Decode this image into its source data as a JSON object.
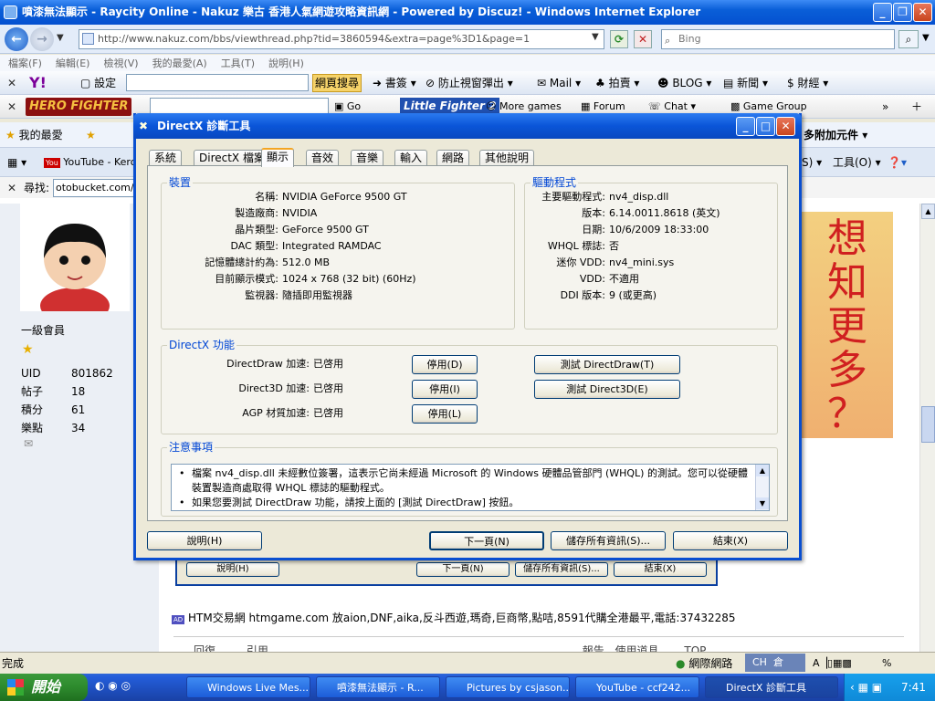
{
  "ie": {
    "title": "噴漆無法顯示 - Raycity Online - Nakuz 樂古 香港人氣網遊攻略資訊網 - Powered by Discuz! - Windows Internet Explorer",
    "address": "http://www.nakuz.com/bbs/viewthread.php?tid=3860594&extra=page%3D1&page=1",
    "search_placeholder": "Bing",
    "menu": [
      "檔案(F)",
      "編輯(E)",
      "檢視(V)",
      "我的最愛(A)",
      "工具(T)",
      "說明(H)"
    ],
    "yahoo_toolbar": {
      "settings": "設定",
      "search_btn": "網頁搜尋",
      "bookmarks": "書簽",
      "popup_block": "防止視窗彈出",
      "mail": "Mail",
      "auction": "拍賣",
      "blog": "BLOG",
      "news": "新聞",
      "finance": "財經"
    },
    "game_toolbar": {
      "brand": "HERO FIGHTER",
      "go": "Go",
      "game": "Little Fighter 2",
      "more_games": "More games",
      "forum": "Forum",
      "chat": "Chat",
      "group": "Game Group"
    },
    "fav_bar": {
      "favorites": "我的最愛",
      "addons": "多附加元件"
    },
    "cmd_bar": {
      "youtube_tab": "YouTube - Kero",
      "tools": "工具(O)"
    },
    "find_bar": {
      "label": "尋找:",
      "value": "otobucket.com/al"
    },
    "status_text": "完成",
    "zone": "網際網路",
    "zoom": "%"
  },
  "forum": {
    "rank": "一級會員",
    "stats": [
      {
        "k": "UID",
        "v": "801862"
      },
      {
        "k": "帖子",
        "v": "18"
      },
      {
        "k": "積分",
        "v": "61"
      },
      {
        "k": "樂點",
        "v": "34"
      }
    ],
    "ad_text": "HTM交易網 htmgame.com 放aion,DNF,aika,反斗西遊,瑪奇,巨商幣,點咭,8591代購全港最平,電話:37432285",
    "reply": "回復",
    "quote": "引用",
    "report": "報告",
    "use_item": "使用道具",
    "top": "TOP",
    "banner": [
      "想",
      "知",
      "更",
      "多",
      "？"
    ],
    "bg_buttons": [
      "說明(H)",
      "下一頁(N)",
      "儲存所有資訊(S)...",
      "結束(X)"
    ]
  },
  "dialog": {
    "title": "DirectX 診斷工具",
    "tabs": [
      "系統",
      "DirectX 檔案",
      "顯示",
      "音效",
      "音樂",
      "輸入",
      "網路",
      "其他說明"
    ],
    "device_title": "裝置",
    "device": [
      {
        "k": "名稱:",
        "v": "NVIDIA GeForce 9500 GT"
      },
      {
        "k": "製造廠商:",
        "v": "NVIDIA"
      },
      {
        "k": "晶片類型:",
        "v": "GeForce 9500 GT"
      },
      {
        "k": "DAC 類型:",
        "v": "Integrated RAMDAC"
      },
      {
        "k": "記憶體總計約為:",
        "v": "512.0 MB"
      },
      {
        "k": "目前顯示模式:",
        "v": "1024 x 768 (32 bit) (60Hz)"
      },
      {
        "k": "監視器:",
        "v": "隨插即用監視器"
      }
    ],
    "driver_title": "驅動程式",
    "driver": [
      {
        "k": "主要驅動程式:",
        "v": "nv4_disp.dll"
      },
      {
        "k": "版本:",
        "v": "6.14.0011.8618 (英文)"
      },
      {
        "k": "日期:",
        "v": "10/6/2009 18:33:00"
      },
      {
        "k": "WHQL 標誌:",
        "v": "否"
      },
      {
        "k": "迷你 VDD:",
        "v": "nv4_mini.sys"
      },
      {
        "k": "VDD:",
        "v": "不適用"
      },
      {
        "k": "DDI 版本:",
        "v": "9 (或更高)"
      }
    ],
    "dx_title": "DirectX 功能",
    "dx": [
      {
        "k": "DirectDraw 加速:",
        "v": "已啓用",
        "btn": "停用(D)",
        "test": "測試 DirectDraw(T)"
      },
      {
        "k": "Direct3D 加速:",
        "v": "已啓用",
        "btn": "停用(I)",
        "test": "測試 Direct3D(E)"
      },
      {
        "k": "AGP 材質加速:",
        "v": "已啓用",
        "btn": "停用(L)",
        "test": ""
      }
    ],
    "notes_title": "注意事項",
    "notes": [
      "檔案 nv4_disp.dll 未經數位簽署，這表示它尚未經過 Microsoft 的 Windows 硬體品管部門 (WHQL) 的測試。您可以從硬體裝置製造商處取得 WHQL 標誌的驅動程式。",
      "如果您要測試 DirectDraw 功能，請按上面的 [測試 DirectDraw] 按鈕。"
    ],
    "buttons": {
      "help": "說明(H)",
      "next": "下一頁(N)",
      "save": "儲存所有資訊(S)...",
      "exit": "結束(X)"
    }
  },
  "taskbar": {
    "start": "開始",
    "tasks": [
      "Windows Live Mes...",
      "噴漆無法顯示 - R...",
      "Pictures by csjason...",
      "YouTube - ccf242...",
      "DirectX 診斷工具"
    ],
    "lang": "CH",
    "ime": "倉",
    "clock": "7:41"
  }
}
